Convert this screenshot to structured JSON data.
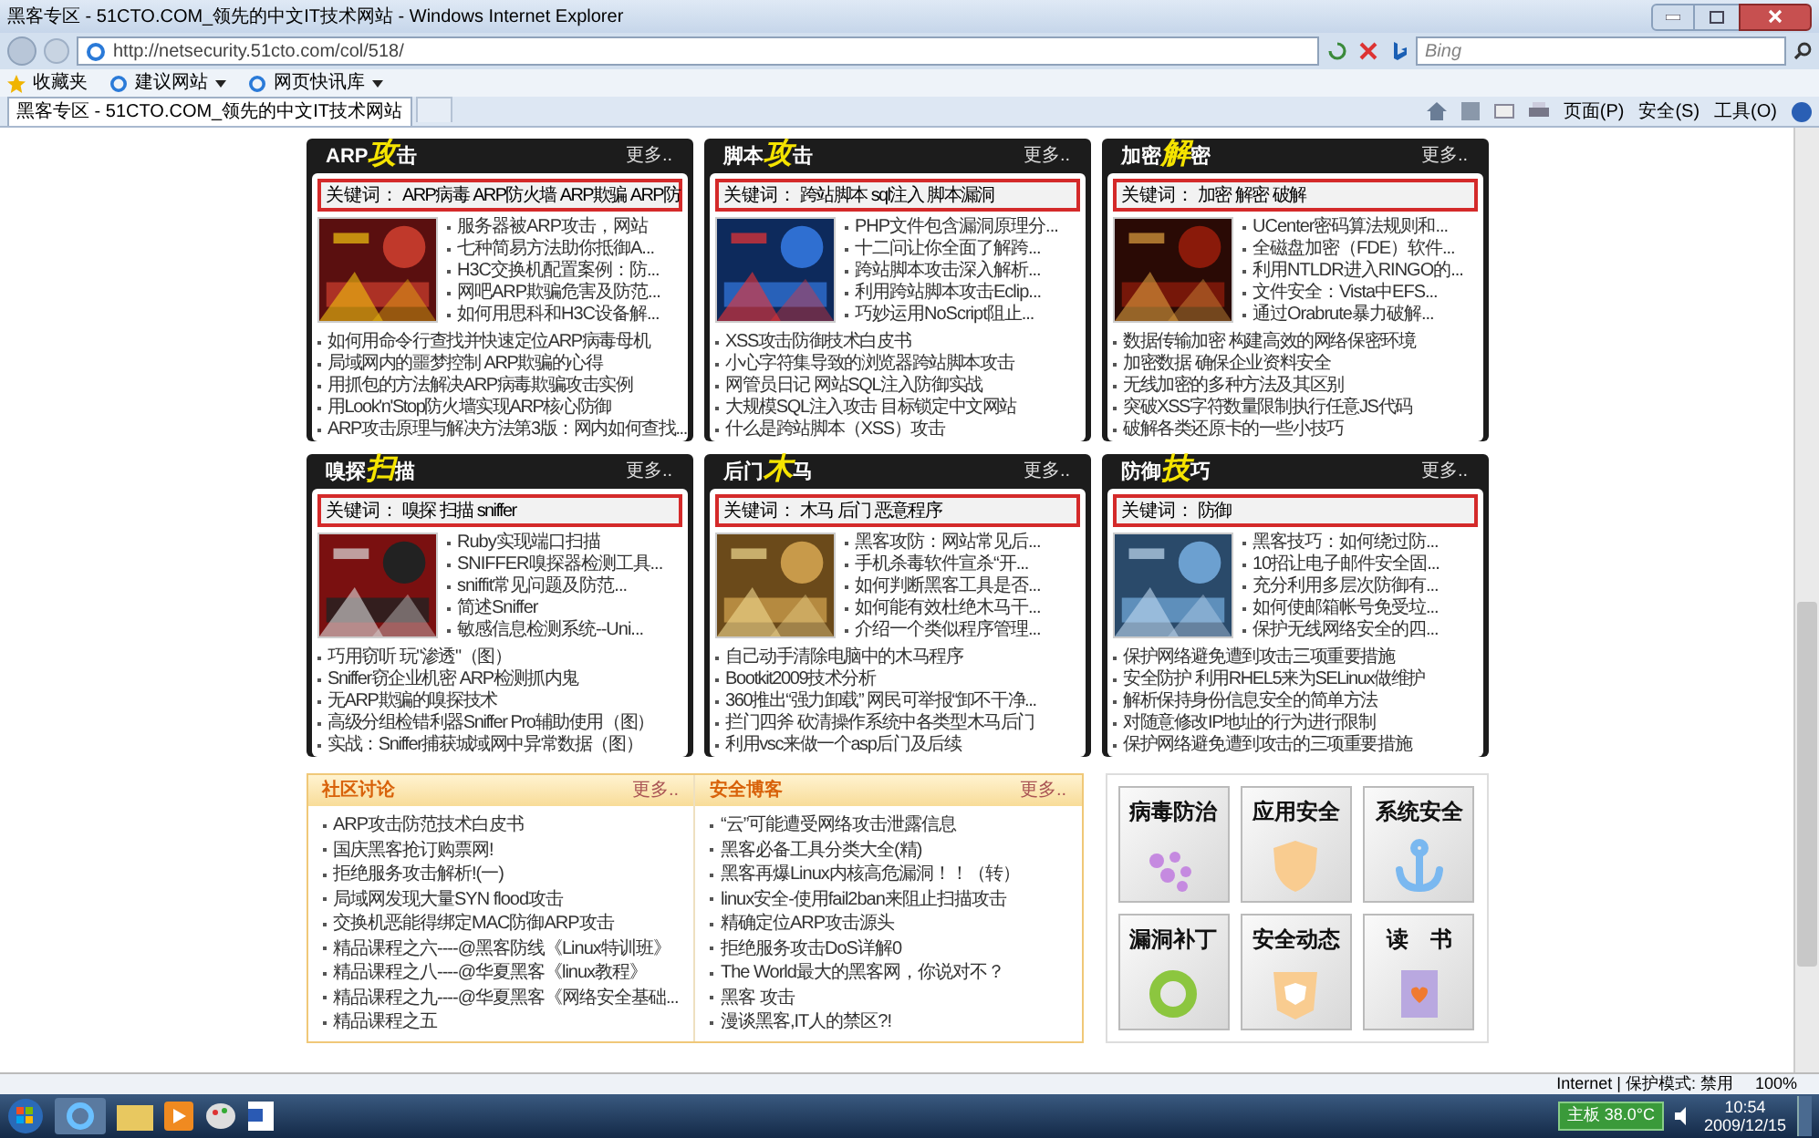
{
  "window": {
    "title": "黑客专区 - 51CTO.COM_领先的中文IT技术网站 - Windows Internet Explorer"
  },
  "address_bar": {
    "url": "http://netsecurity.51cto.com/col/518/",
    "search_placeholder": "Bing"
  },
  "favorites_bar": {
    "label": "收藏夹",
    "items": [
      "建议网站",
      "网页快讯库"
    ]
  },
  "tabs": [
    {
      "label": "黑客专区 - 51CTO.COM_领先的中文IT技术网站",
      "selected": true
    }
  ],
  "command_bar": [
    "页面(P)",
    "安全(S)",
    "工具(O)"
  ],
  "panels": [
    {
      "title": {
        "before": "ARP",
        "accent": "攻",
        "after": "击"
      },
      "more": "更多..",
      "keywords_label": "关键词：",
      "keywords": [
        "ARP病毒",
        "ARP防火墙",
        "ARP欺骗",
        "ARP防"
      ],
      "side_links": [
        "服务器被ARP攻击，网站",
        "七种简易方法助你抵御A...",
        "H3C交换机配置案例：防...",
        "网吧ARP欺骗危害及防范...",
        "如何用思科和H3C设备解..."
      ],
      "links": [
        "如何用命令行查找并快速定位ARP病毒母机",
        "局域网内的噩梦控制 ARP欺骗的心得",
        "用抓包的方法解决ARP病毒欺骗攻击实例",
        "用Look'n'Stop防火墙实现ARP核心防御",
        "ARP攻击原理与解决方法第3版：网内如何查找..."
      ]
    },
    {
      "title": {
        "before": "脚本",
        "accent": "攻",
        "after": "击"
      },
      "more": "更多..",
      "keywords_label": "关键词：",
      "keywords": [
        "跨站脚本",
        "sql注入",
        "脚本漏洞"
      ],
      "side_links": [
        "PHP文件包含漏洞原理分...",
        "十二问让你全面了解跨...",
        "跨站脚本攻击深入解析...",
        "利用跨站脚本攻击Eclip...",
        "巧妙运用NoScript阻止..."
      ],
      "links": [
        "XSS攻击防御技术白皮书",
        "小心字符集导致的浏览器跨站脚本攻击",
        "网管员日记 网站SQL注入防御实战",
        "大规模SQL注入攻击 目标锁定中文网站",
        "什么是跨站脚本（XSS）攻击"
      ]
    },
    {
      "title": {
        "before": "加密",
        "accent": "解",
        "after": "密"
      },
      "more": "更多..",
      "keywords_label": "关键词：",
      "keywords": [
        "加密",
        "解密",
        "破解"
      ],
      "side_links": [
        "UCenter密码算法规则和...",
        "全磁盘加密（FDE）软件...",
        "利用NTLDR进入RINGO的...",
        "文件安全：Vista中EFS...",
        "通过Orabrute暴力破解..."
      ],
      "links": [
        "数据传输加密 构建高效的网络保密环境",
        "加密数据 确保企业资料安全",
        "无线加密的多种方法及其区别",
        "突破XSS字符数量限制执行任意JS代码",
        "破解各类还原卡的一些小技巧"
      ]
    },
    {
      "title": {
        "before": "嗅探",
        "accent": "扫",
        "after": "描"
      },
      "more": "更多..",
      "keywords_label": "关键词：",
      "keywords": [
        "嗅探",
        "扫描",
        "sniffer"
      ],
      "side_links": [
        "Ruby实现端口扫描",
        "SNIFFER嗅探器检测工具...",
        "sniffit常见问题及防范...",
        "简述Sniffer",
        "敏感信息检测系统--Uni..."
      ],
      "links": [
        "巧用窃听 玩\"渗透\"（图）",
        "Sniffer窃企业机密 ARP检测抓内鬼",
        "无ARP欺骗的嗅探技术",
        "高级分组检错利器Sniffer Pro辅助使用（图）",
        "实战：Sniffer捕获城域网中异常数据（图）"
      ]
    },
    {
      "title": {
        "before": "后门",
        "accent": "木",
        "after": "马"
      },
      "more": "更多..",
      "keywords_label": "关键词：",
      "keywords": [
        "木马",
        "后门",
        "恶意程序"
      ],
      "side_links": [
        "黑客攻防：网站常见后...",
        "手机杀毒软件宣杀“开...",
        "如何判断黑客工具是否...",
        "如何能有效杜绝木马干...",
        "介绍一个类似程序管理..."
      ],
      "links": [
        "自己动手清除电脑中的木马程序",
        "Bootkit2009技术分析",
        "360推出“强力卸载” 网民可举报“卸不干净...",
        "拦门四斧 砍清操作系统中各类型木马后门",
        "利用vsc来做一个asp后门及后续"
      ]
    },
    {
      "title": {
        "before": "防御",
        "accent": "技",
        "after": "巧"
      },
      "more": "更多..",
      "keywords_label": "关键词：",
      "keywords": [
        "防御"
      ],
      "side_links": [
        "黑客技巧：如何绕过防...",
        "10招让电子邮件安全固...",
        "充分利用多层次防御有...",
        "如何使邮箱帐号免受垃...",
        "保护无线网络安全的四..."
      ],
      "links": [
        "保护网络避免遭到攻击三项重要措施",
        "安全防护 利用RHEL5来为SELinux做维护",
        "解析保持身份信息安全的简单方法",
        "对随意修改IP地址的行为进行限制",
        "保护网络避免遭到攻击的三项重要措施"
      ]
    }
  ],
  "bottom_lists": [
    {
      "title": "社区讨论",
      "more": "更多..",
      "items": [
        "ARP攻击防范技术白皮书",
        "国庆黑客抢订购票网!",
        "拒绝服务攻击解析!(一)",
        "局域网发现大量SYN flood攻击",
        "交换机恶能得绑定MAC防御ARP攻击",
        "精品课程之六----@黑客防线《Linux特训班》",
        "精品课程之八----@华夏黑客《linux教程》",
        "精品课程之九----@华夏黑客《网络安全基础...",
        "精品课程之五"
      ]
    },
    {
      "title": "安全博客",
      "more": "更多..",
      "items": [
        "“云”可能遭受网络攻击泄露信息",
        "黑客必备工具分类大全(精)",
        "黑客再爆Linux内核高危漏洞！！（转）",
        "linux安全-使用fail2ban来阻止扫描攻击",
        "精确定位ARP攻击源头",
        "拒绝服务攻击DoS详解0",
        "The World最大的黑客网，你说对不？",
        "黑客 攻击",
        "漫谈黑客,IT人的禁区?!"
      ]
    }
  ],
  "categories": [
    {
      "label": "病毒防治",
      "kind": "virus"
    },
    {
      "label": "应用安全",
      "kind": "shield"
    },
    {
      "label": "系统安全",
      "kind": "anchor"
    },
    {
      "label": "漏洞补丁",
      "kind": "patch"
    },
    {
      "label": "安全动态",
      "kind": "news"
    },
    {
      "label": "读　书",
      "kind": "book"
    }
  ],
  "status_bar": {
    "zone": "Internet | 保护模式: 禁用",
    "zoom": "100%"
  },
  "taskbar": {
    "temperature": "主板 38.0°C",
    "time": "10:54",
    "date": "2009/12/15"
  }
}
